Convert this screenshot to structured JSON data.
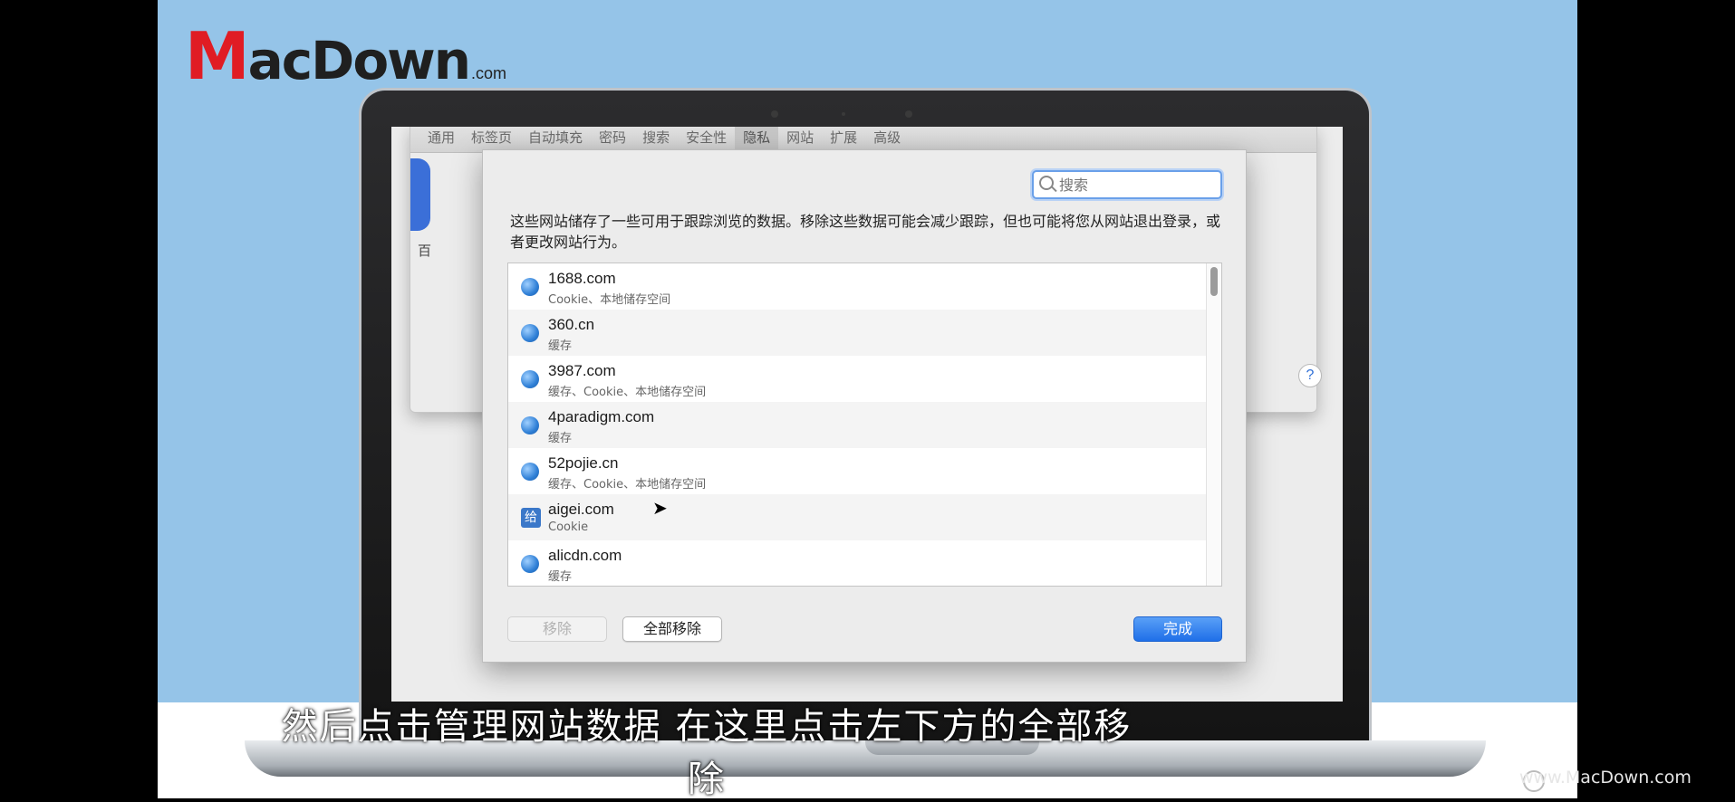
{
  "logo": {
    "brand_m": "M",
    "brand_rest": "acDown",
    "domain": ".com"
  },
  "prefs": {
    "tabs": [
      "通用",
      "标签页",
      "自动填充",
      "密码",
      "搜索",
      "安全性",
      "隐私",
      "网站",
      "扩展",
      "高级"
    ],
    "active_tab": "隐私",
    "side_text": "百",
    "help_label": "?"
  },
  "sheet": {
    "search_placeholder": "搜索",
    "description": "这些网站储存了一些可用于跟踪浏览的数据。移除这些数据可能会减少跟踪，但也可能将您从网站退出登录，或者更改网站行为。",
    "sites": [
      {
        "name": "1688.com",
        "data": "Cookie、本地储存空间",
        "icon": "globe-icon"
      },
      {
        "name": "360.cn",
        "data": "缓存",
        "icon": "globe-icon"
      },
      {
        "name": "3987.com",
        "data": "缓存、Cookie、本地储存空间",
        "icon": "globe-icon"
      },
      {
        "name": "4paradigm.com",
        "data": "缓存",
        "icon": "globe-icon"
      },
      {
        "name": "52pojie.cn",
        "data": "缓存、Cookie、本地储存空间",
        "icon": "globe-icon"
      },
      {
        "name": "aigei.com",
        "data": "Cookie",
        "icon": "aigei-favicon-icon",
        "favicon_text": "给"
      },
      {
        "name": "alicdn.com",
        "data": "缓存",
        "icon": "globe-icon"
      }
    ],
    "buttons": {
      "remove": "移除",
      "remove_all": "全部移除",
      "done": "完成"
    }
  },
  "subtitle": "然后点击管理网站数据  在这里点击左下方的全部移除",
  "watermark": "www.MacDown.com",
  "colors": {
    "background": "#95c4e8",
    "accent": "#1f6fe8",
    "brand_red": "#e01c24"
  }
}
